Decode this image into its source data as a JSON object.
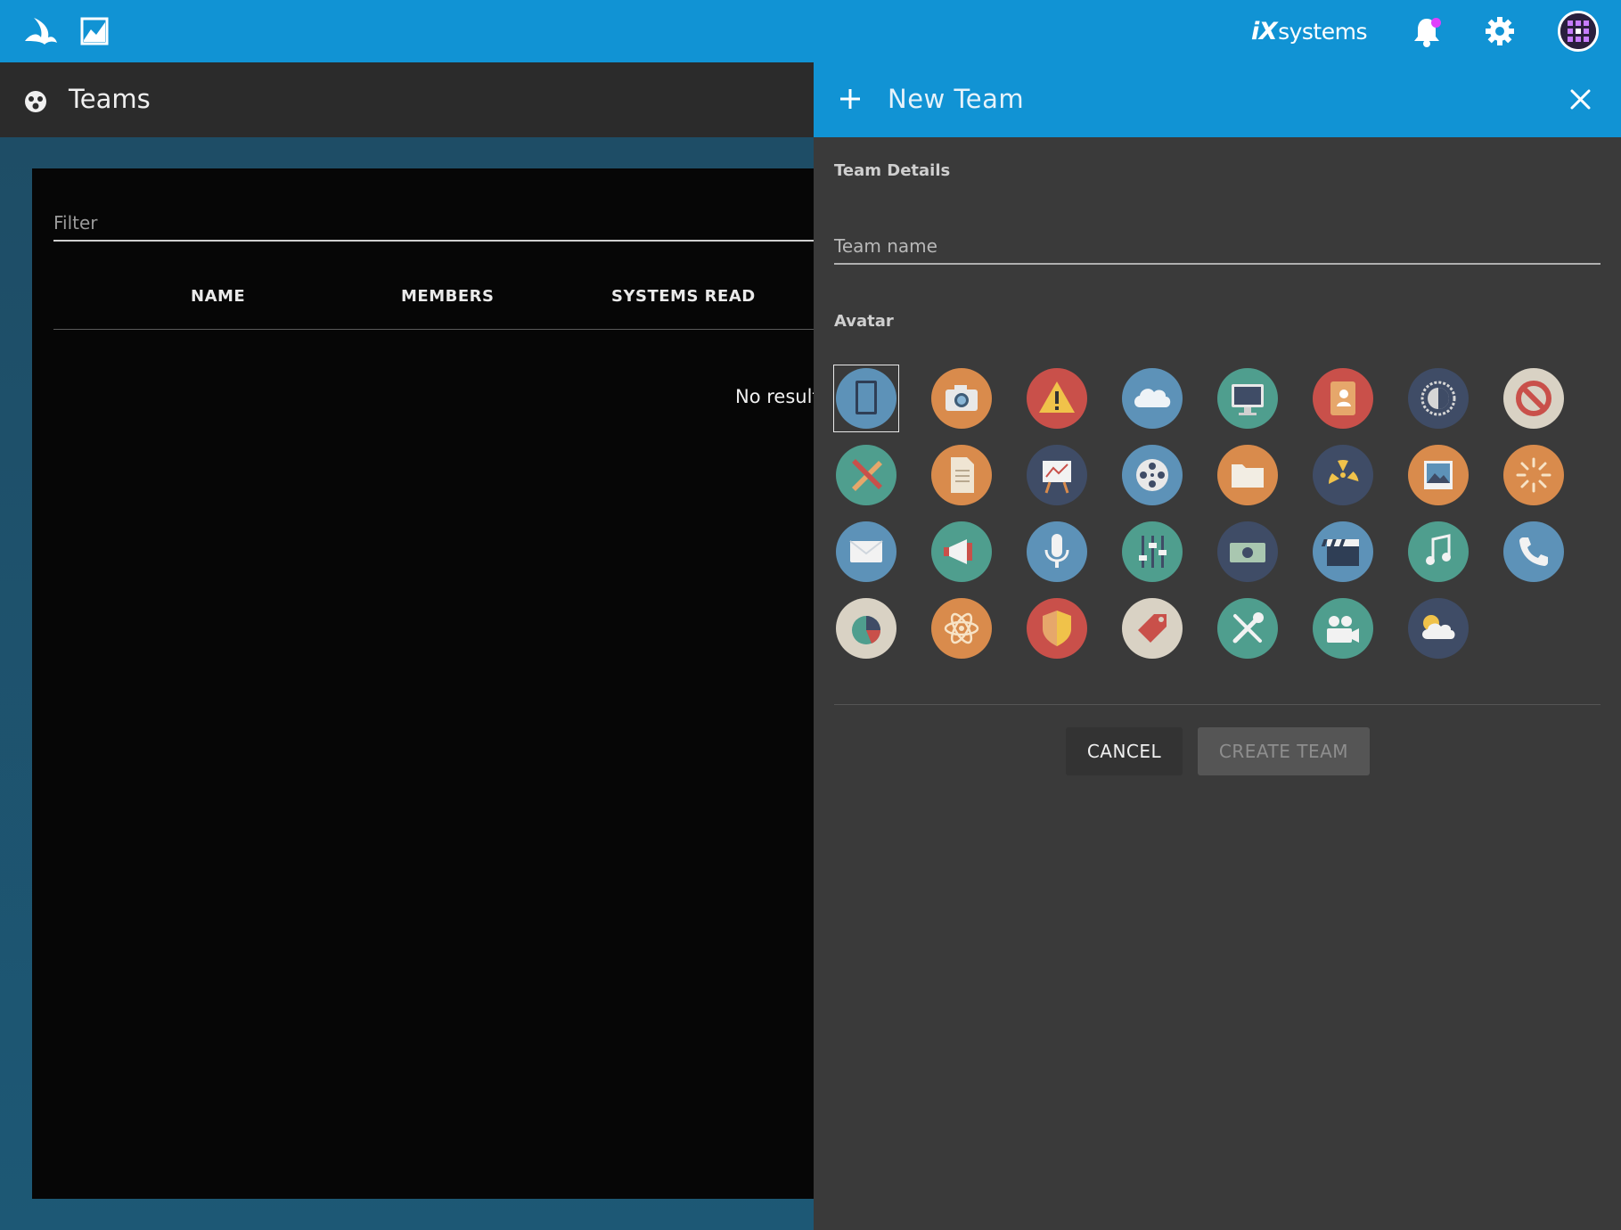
{
  "topbar": {
    "brand_prefix": "iX",
    "brand_suffix": "systems",
    "icons": [
      "truenas-logo-icon",
      "chart-icon",
      "bell-icon",
      "gear-icon",
      "user-avatar"
    ],
    "accent": "#1193d4",
    "notification_dot": "#e040fb"
  },
  "page": {
    "title": "Teams",
    "filter_placeholder": "Filter",
    "columns": [
      "NAME",
      "MEMBERS",
      "SYSTEMS READ"
    ],
    "empty_text": "No results"
  },
  "panel": {
    "title": "New Team",
    "section_details": "Team Details",
    "team_name_placeholder": "Team name",
    "section_avatar": "Avatar",
    "cancel_label": "CANCEL",
    "create_label": "CREATE TEAM",
    "selected_avatar": 0,
    "avatars": [
      {
        "name": "notebook",
        "bg": "#5d92b8"
      },
      {
        "name": "camera",
        "bg": "#d98b4c"
      },
      {
        "name": "warning",
        "bg": "#c9504a"
      },
      {
        "name": "cloud",
        "bg": "#5d92b8"
      },
      {
        "name": "monitor",
        "bg": "#4f9e8e"
      },
      {
        "name": "contacts",
        "bg": "#c9504a"
      },
      {
        "name": "aperture",
        "bg": "#3f4c66"
      },
      {
        "name": "forbidden",
        "bg": "#d9d2c4"
      },
      {
        "name": "tools-pencil",
        "bg": "#4f9e8e"
      },
      {
        "name": "document",
        "bg": "#d98b4c"
      },
      {
        "name": "presentation",
        "bg": "#3f4c66"
      },
      {
        "name": "film-reel",
        "bg": "#5d92b8"
      },
      {
        "name": "folder",
        "bg": "#d98b4c"
      },
      {
        "name": "radiation",
        "bg": "#3f4c66"
      },
      {
        "name": "picture",
        "bg": "#d98b4c"
      },
      {
        "name": "loading-burst",
        "bg": "#d98b4c"
      },
      {
        "name": "mail",
        "bg": "#5d92b8"
      },
      {
        "name": "megaphone",
        "bg": "#4f9e8e"
      },
      {
        "name": "microphone",
        "bg": "#5d92b8"
      },
      {
        "name": "equalizer",
        "bg": "#4f9e8e"
      },
      {
        "name": "money",
        "bg": "#3f4c66"
      },
      {
        "name": "clapperboard",
        "bg": "#5d92b8"
      },
      {
        "name": "music-note",
        "bg": "#4f9e8e"
      },
      {
        "name": "phone",
        "bg": "#5d92b8"
      },
      {
        "name": "pie-chart",
        "bg": "#d9d2c4"
      },
      {
        "name": "atom",
        "bg": "#d98b4c"
      },
      {
        "name": "shield",
        "bg": "#c9504a"
      },
      {
        "name": "tag",
        "bg": "#d9d2c4"
      },
      {
        "name": "wrench-screwdriver",
        "bg": "#4f9e8e"
      },
      {
        "name": "video-camera",
        "bg": "#4f9e8e"
      },
      {
        "name": "cloud-sun",
        "bg": "#3f4c66"
      }
    ]
  }
}
